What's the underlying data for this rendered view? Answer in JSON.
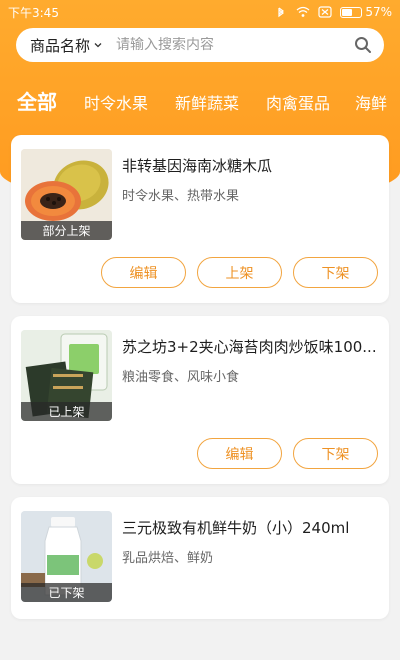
{
  "status_bar": {
    "time": "下午3:45",
    "battery": "57%",
    "battery_level": 0.57
  },
  "search": {
    "category": "商品名称",
    "placeholder": "请输入搜索内容"
  },
  "tabs": [
    {
      "label": "全部",
      "active": true
    },
    {
      "label": "时令水果",
      "active": false
    },
    {
      "label": "新鲜蔬菜",
      "active": false
    },
    {
      "label": "肉禽蛋品",
      "active": false
    },
    {
      "label": "海鲜",
      "active": false
    }
  ],
  "products": [
    {
      "title": "非转基因海南冰糖木瓜",
      "category": "时令水果、热带水果",
      "status": "部分上架",
      "buttons": [
        "编辑",
        "上架",
        "下架"
      ]
    },
    {
      "title": "苏之坊3+2夹心海苔肉肉炒饭味100...",
      "category": "粮油零食、风味小食",
      "status": "已上架",
      "buttons": [
        "编辑",
        "下架"
      ]
    },
    {
      "title": "三元极致有机鲜牛奶（小）240ml",
      "category": "乳品烘焙、鲜奶",
      "status": "已下架",
      "buttons": []
    }
  ],
  "colors": {
    "accent": "#ff9f24",
    "button_border": "#f2a540",
    "button_text": "#ee9225"
  }
}
